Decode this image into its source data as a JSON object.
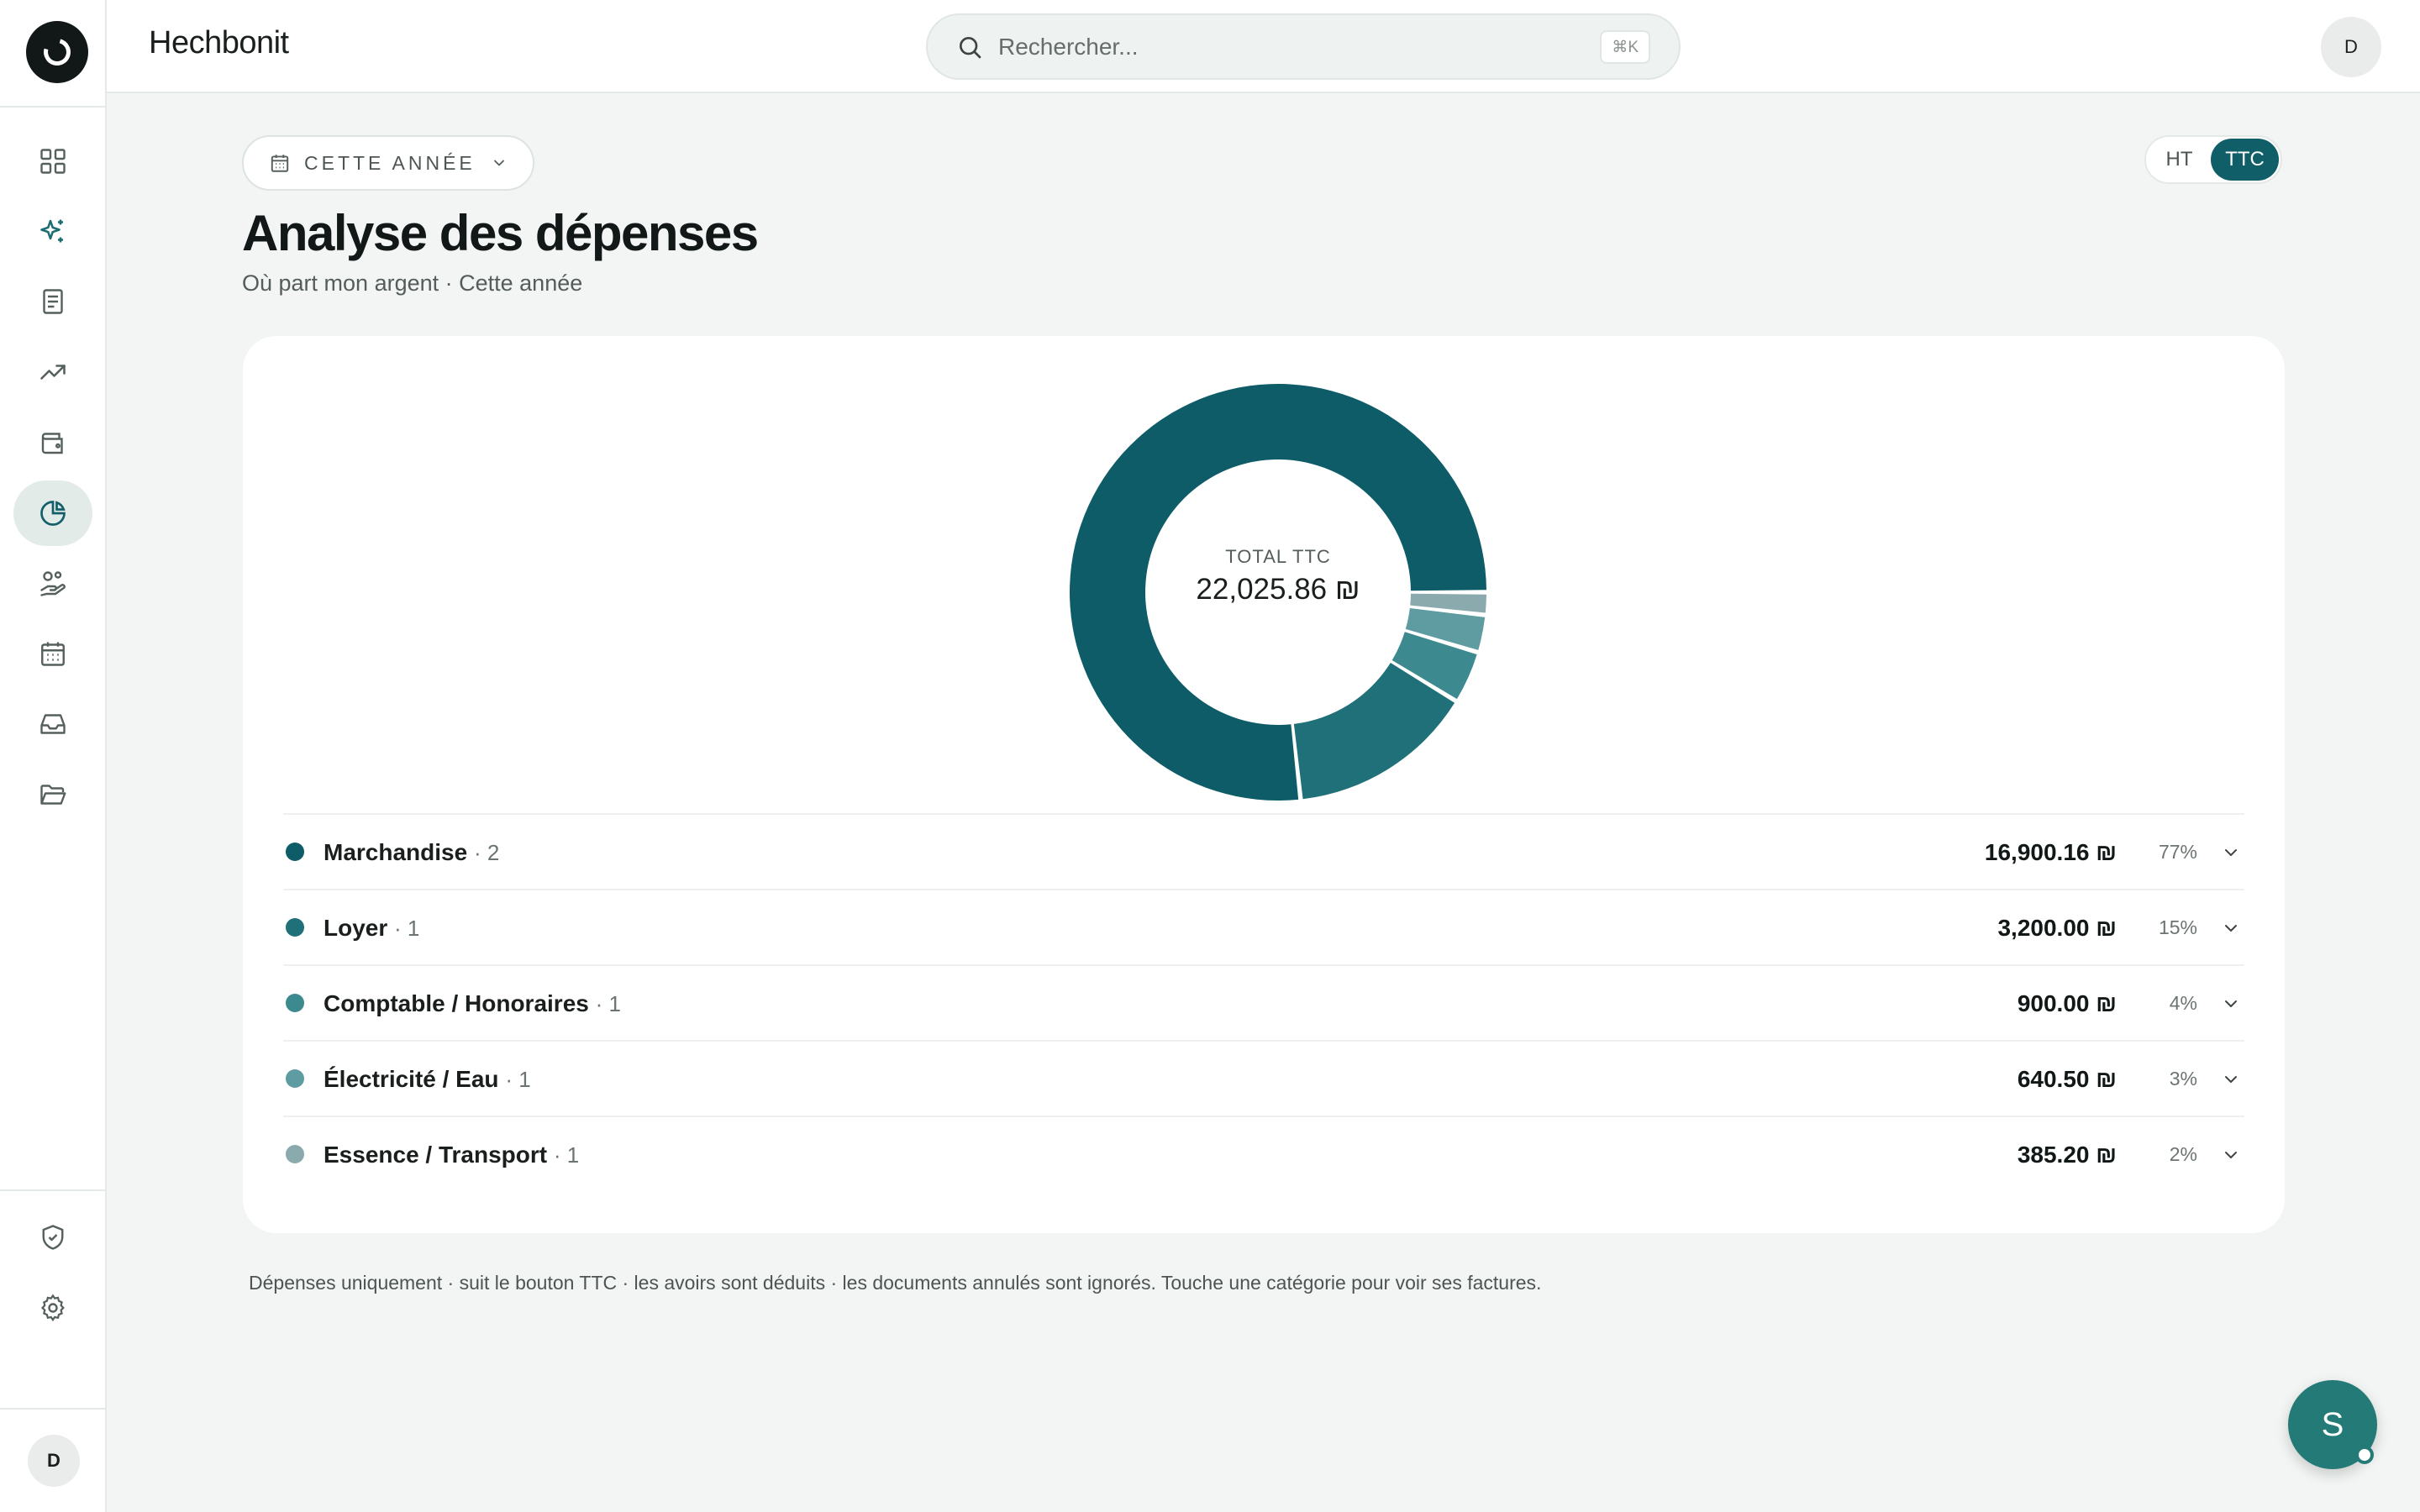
{
  "app": {
    "title": "Hechbonit"
  },
  "search": {
    "placeholder": "Rechercher...",
    "shortcut": "⌘K"
  },
  "user": {
    "initial": "D"
  },
  "sidebar": {
    "items": [
      {
        "icon": "dashboard-icon",
        "active": false
      },
      {
        "icon": "sparkles-icon",
        "active": false
      },
      {
        "icon": "receipt-icon",
        "active": false
      },
      {
        "icon": "trending-up-icon",
        "active": false
      },
      {
        "icon": "wallet-icon",
        "active": false
      },
      {
        "icon": "pie-chart-icon",
        "active": true
      },
      {
        "icon": "hand-coins-icon",
        "active": false
      },
      {
        "icon": "calendar-icon",
        "active": false
      },
      {
        "icon": "inbox-icon",
        "active": false
      },
      {
        "icon": "folder-icon",
        "active": false
      },
      {
        "icon": "shield-check-icon",
        "active": false
      },
      {
        "icon": "settings-icon",
        "active": false
      }
    ],
    "user_initial": "D"
  },
  "period": {
    "label": "CETTE ANNÉE"
  },
  "toggle": {
    "ht_label": "HT",
    "ttc_label": "TTC",
    "selected": "TTC"
  },
  "page": {
    "title": "Analyse des dépenses",
    "subtitle": "Où part mon argent · Cette année"
  },
  "chart_data": {
    "type": "pie",
    "variant": "donut",
    "center_label": "TOTAL TTC",
    "center_value": "22,025.86 ₪",
    "categories": [
      "Marchandise",
      "Loyer",
      "Comptable / Honoraires",
      "Électricité / Eau",
      "Essence / Transport"
    ],
    "values": [
      16900.16,
      3200.0,
      900.0,
      640.5,
      385.2
    ],
    "colors": [
      "#0d5c68",
      "#1f7078",
      "#3c8a8f",
      "#5e9ca1",
      "#8aaaae"
    ]
  },
  "categories": [
    {
      "name": "Marchandise",
      "count": "· 2",
      "amount": "16,900.16 ₪",
      "pct": "77%",
      "color": "#0d5c68"
    },
    {
      "name": "Loyer",
      "count": "· 1",
      "amount": "3,200.00 ₪",
      "pct": "15%",
      "color": "#1f7078"
    },
    {
      "name": "Comptable / Honoraires",
      "count": "· 1",
      "amount": "900.00 ₪",
      "pct": "4%",
      "color": "#3c8a8f"
    },
    {
      "name": "Électricité / Eau",
      "count": "· 1",
      "amount": "640.50 ₪",
      "pct": "3%",
      "color": "#5e9ca1"
    },
    {
      "name": "Essence / Transport",
      "count": "· 1",
      "amount": "385.20 ₪",
      "pct": "2%",
      "color": "#8aaaae"
    }
  ],
  "footnote": "Dépenses uniquement · suit le bouton TTC · les avoirs sont déduits · les documents annulés sont ignorés. Touche une catégorie pour voir ses factures.",
  "assistant": {
    "initial": "S"
  }
}
